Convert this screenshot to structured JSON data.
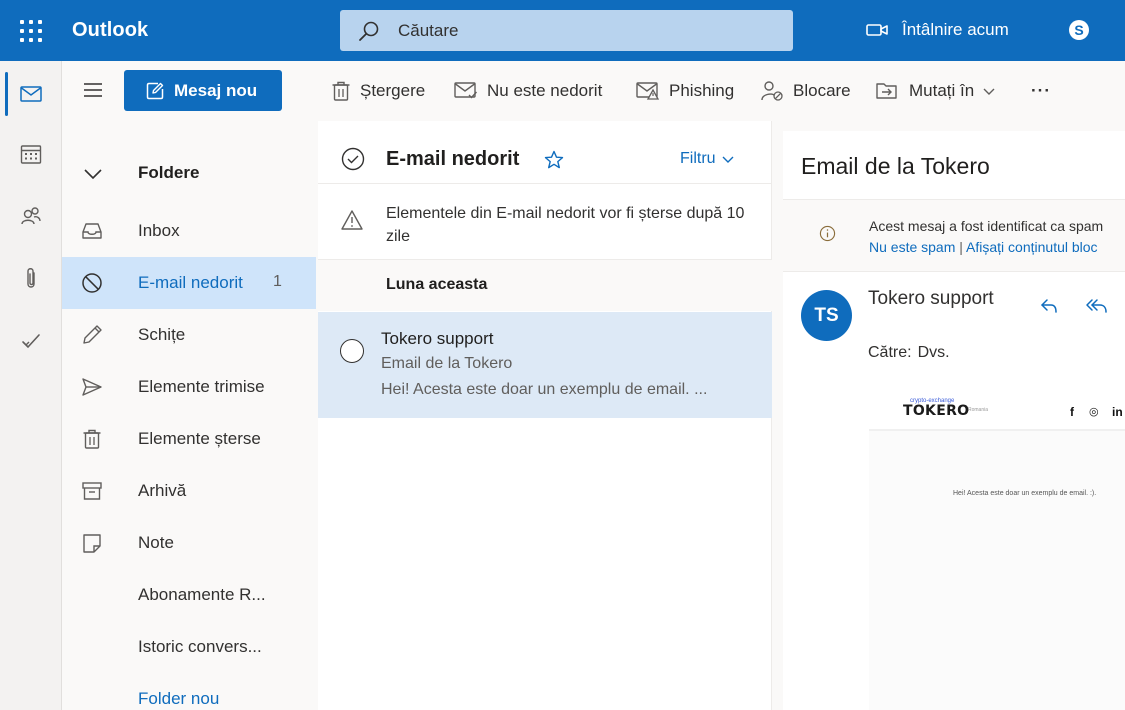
{
  "app": {
    "name": "Outlook"
  },
  "search": {
    "placeholder": "Căutare"
  },
  "header": {
    "meet_now": "Întâlnire acum",
    "skype_icon": "skype-icon"
  },
  "rail": {
    "items": [
      "mail-icon",
      "calendar-icon",
      "people-icon",
      "attachment-icon",
      "todo-icon"
    ]
  },
  "new_message": {
    "label": "Mesaj nou"
  },
  "folders": {
    "header": "Foldere",
    "items": [
      {
        "label": "Inbox",
        "icon": "inbox-icon"
      },
      {
        "label": "E-mail nedorit",
        "icon": "blocked-icon",
        "count": "1",
        "selected": true
      },
      {
        "label": "Schițe",
        "icon": "pencil-icon"
      },
      {
        "label": "Elemente trimise",
        "icon": "send-icon"
      },
      {
        "label": "Elemente șterse",
        "icon": "trash-icon"
      },
      {
        "label": "Arhivă",
        "icon": "archive-icon"
      },
      {
        "label": "Note",
        "icon": "note-icon"
      },
      {
        "label": "Abonamente R..."
      },
      {
        "label": "Istoric convers..."
      },
      {
        "label": "Folder nou"
      }
    ]
  },
  "toolbar": {
    "delete": "Ștergere",
    "not_junk": "Nu este nedorit",
    "phishing": "Phishing",
    "block": "Blocare",
    "move_to": "Mutați în",
    "more": "···"
  },
  "message_list": {
    "title": "E-mail nedorit",
    "filter": "Filtru",
    "notice": "Elementele din E-mail nedorit vor fi șterse după 10 zile",
    "group": "Luna aceasta",
    "items": [
      {
        "sender": "Tokero support",
        "subject": "Email de la Tokero",
        "preview": "Hei! Acesta este doar un exemplu de email.  ..."
      }
    ]
  },
  "reading_pane": {
    "title": "Email de la Tokero",
    "banner_text": "Acest mesaj a fost identificat ca spam",
    "banner_link1": "Nu este spam",
    "banner_sep": " | ",
    "banner_link2": "Afișați conținutul bloc",
    "avatar": "TS",
    "sender": "Tokero support",
    "to_label": "Către:",
    "to_value": "Dvs.",
    "body": {
      "logo_tag": "crypto-exchange",
      "logo": "TOKERO",
      "logo_sub": "Romania",
      "social": [
        "f",
        "◎",
        "in"
      ],
      "text": "Hei! Acesta este doar un exemplu de email. :)."
    }
  },
  "colors": {
    "accent": "#0f6cbd",
    "selected": "#cfe4fa",
    "item_selected": "#dde9f6"
  }
}
